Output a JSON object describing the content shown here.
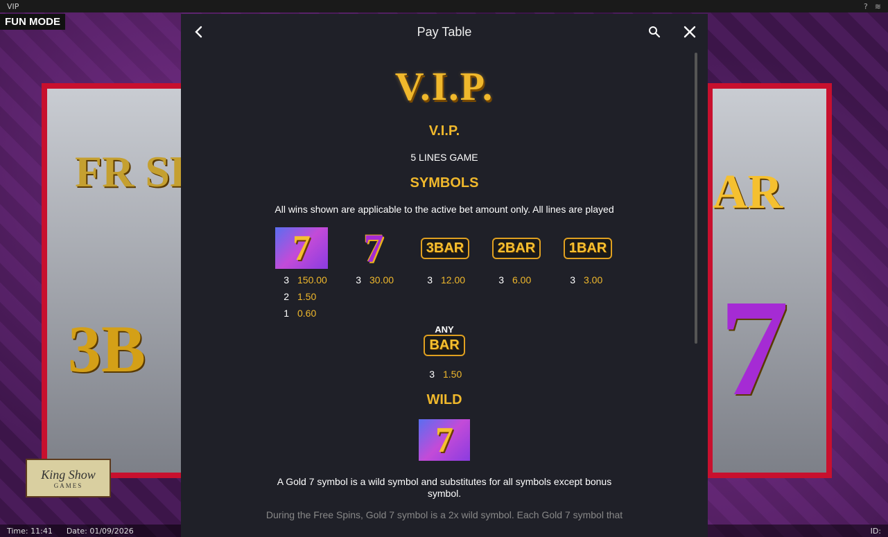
{
  "window": {
    "title": "VIP",
    "help": "?",
    "wifi_icon": "wifi-icon"
  },
  "game": {
    "mode": "FUN MODE",
    "brand_line1": "King Show",
    "brand_line2": "GAMES"
  },
  "background_symbols": {
    "left_top": "FR SP",
    "left_bottom": "3B",
    "right_top": "AR",
    "right_bottom": "7"
  },
  "status": {
    "time": "Time: 11:41",
    "date": "Date: 01/09/2026",
    "id": "ID:"
  },
  "paytable": {
    "title": "Pay Table",
    "logo": "V.I.P.",
    "game_name": "V.I.P.",
    "lines": "5 LINES GAME",
    "symbols_title": "SYMBOLS",
    "note": "All wins shown are applicable to the active bet amount only. All lines are played",
    "symbols": [
      {
        "icon": "gold-seven-wild",
        "glyph": "7",
        "pays": [
          {
            "n": "3",
            "v": "150.00"
          },
          {
            "n": "2",
            "v": "1.50"
          },
          {
            "n": "1",
            "v": "0.60"
          }
        ]
      },
      {
        "icon": "purple-seven",
        "glyph": "7",
        "pays": [
          {
            "n": "3",
            "v": "30.00"
          }
        ]
      },
      {
        "icon": "triple-bar",
        "glyph": "3BAR",
        "pays": [
          {
            "n": "3",
            "v": "12.00"
          }
        ]
      },
      {
        "icon": "double-bar",
        "glyph": "2BAR",
        "pays": [
          {
            "n": "3",
            "v": "6.00"
          }
        ]
      },
      {
        "icon": "single-bar",
        "glyph": "1BAR",
        "pays": [
          {
            "n": "3",
            "v": "3.00"
          }
        ]
      }
    ],
    "any_bar": {
      "label": "ANY",
      "glyph": "BAR",
      "pays": [
        {
          "n": "3",
          "v": "1.50"
        }
      ]
    },
    "wild_title": "WILD",
    "wild_glyph": "7",
    "wild_desc": "A Gold 7 symbol is a wild symbol and substitutes for all symbols except bonus symbol.",
    "wild_desc2": "During the Free Spins, Gold 7 symbol is a 2x wild symbol. Each Gold 7 symbol that"
  },
  "colors": {
    "accent_gold": "#f0b82c",
    "panel_bg": "#1f2028",
    "reel_frame_red": "#c8102e"
  }
}
